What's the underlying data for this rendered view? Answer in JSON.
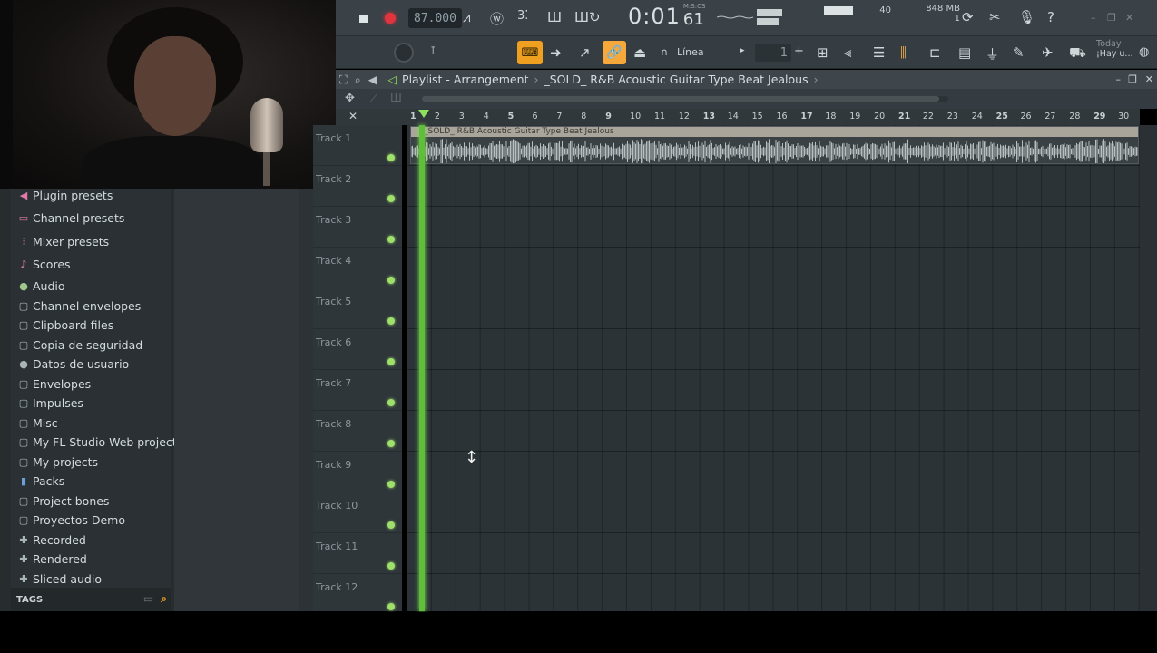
{
  "transport": {
    "tempo": "87.000",
    "time_main": "0:01",
    "time_sub": "61",
    "time_format": "M:S:CS",
    "cpu_value": "40",
    "memory": "848 MB",
    "poly": "1"
  },
  "toolbar2": {
    "snap_label": "Línea",
    "pattern_number": "1",
    "news_title": "Today",
    "news_text": "¡Hay u..."
  },
  "browser": {
    "items": [
      {
        "icon": "plugin-presets-icon",
        "glyph": "◀",
        "color": "pink",
        "label": "Plugin presets"
      },
      {
        "icon": "channel-presets-icon",
        "glyph": "▭",
        "color": "pink",
        "label": "Channel presets"
      },
      {
        "icon": "mixer-presets-icon",
        "glyph": "⫶",
        "color": "pink",
        "label": "Mixer presets"
      },
      {
        "icon": "scores-icon",
        "glyph": "♪",
        "color": "pink",
        "label": "Scores"
      },
      {
        "icon": "audio-icon",
        "glyph": "●",
        "color": "green",
        "label": "Audio"
      },
      {
        "icon": "folder-icon",
        "glyph": "▢",
        "color": "",
        "label": "Channel envelopes"
      },
      {
        "icon": "folder-icon",
        "glyph": "▢",
        "color": "",
        "label": "Clipboard files"
      },
      {
        "icon": "folder-icon",
        "glyph": "▢",
        "color": "",
        "label": "Copia de seguridad"
      },
      {
        "icon": "user-data-icon",
        "glyph": "●",
        "color": "",
        "label": "Datos de usuario"
      },
      {
        "icon": "folder-icon",
        "glyph": "▢",
        "color": "",
        "label": "Envelopes"
      },
      {
        "icon": "folder-icon",
        "glyph": "▢",
        "color": "",
        "label": "Impulses"
      },
      {
        "icon": "folder-icon",
        "glyph": "▢",
        "color": "",
        "label": "Misc"
      },
      {
        "icon": "folder-icon",
        "glyph": "▢",
        "color": "",
        "label": "My FL Studio Web projects"
      },
      {
        "icon": "folder-icon",
        "glyph": "▢",
        "color": "",
        "label": "My projects"
      },
      {
        "icon": "packs-icon",
        "glyph": "▮",
        "color": "blue",
        "label": "Packs"
      },
      {
        "icon": "folder-icon",
        "glyph": "▢",
        "color": "",
        "label": "Project bones"
      },
      {
        "icon": "folder-icon",
        "glyph": "▢",
        "color": "",
        "label": "Proyectos Demo"
      },
      {
        "icon": "recorded-icon",
        "glyph": "✚",
        "color": "",
        "label": "Recorded"
      },
      {
        "icon": "rendered-icon",
        "glyph": "✚",
        "color": "",
        "label": "Rendered"
      },
      {
        "icon": "sliced-audio-icon",
        "glyph": "✚",
        "color": "",
        "label": "Sliced audio"
      }
    ],
    "tags_label": "TAGS"
  },
  "playlist": {
    "title": "Playlist - Arrangement",
    "separator": "›",
    "pattern_name": "_SOLD_ R&B Acoustic Guitar Type Beat  Jealous",
    "clip_label": "_SOLD_ R&B Acoustic Guitar Type Beat  Jealous",
    "ruler": [
      "1",
      "2",
      "3",
      "4",
      "5",
      "6",
      "7",
      "8",
      "9",
      "10",
      "11",
      "12",
      "13",
      "14",
      "15",
      "16",
      "17",
      "18",
      "19",
      "20",
      "21",
      "22",
      "23",
      "24",
      "25",
      "26",
      "27",
      "28",
      "29",
      "30"
    ],
    "tracks": [
      "Track 1",
      "Track 2",
      "Track 3",
      "Track 4",
      "Track 5",
      "Track 6",
      "Track 7",
      "Track 8",
      "Track 9",
      "Track 10",
      "Track 11",
      "Track 12"
    ]
  },
  "colors": {
    "accent_orange": "#f0a020",
    "playhead_green": "#5fbf3a",
    "record_red": "#e0343e"
  }
}
